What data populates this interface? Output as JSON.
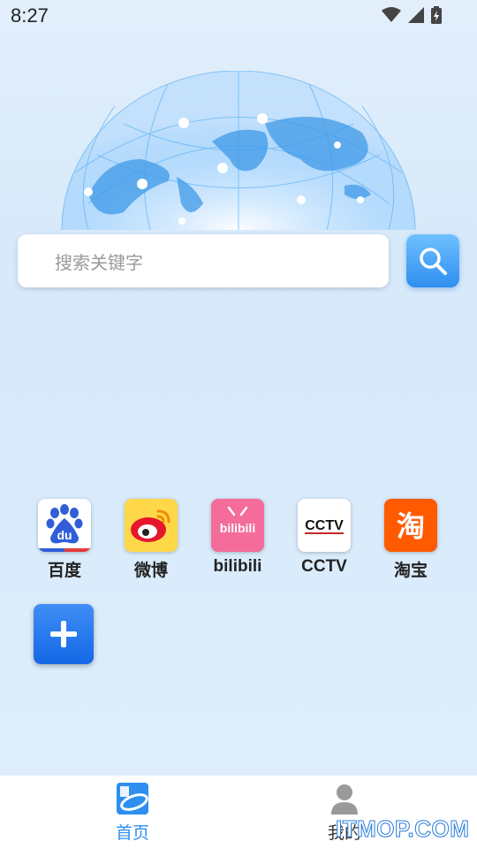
{
  "status_bar": {
    "time": "8:27"
  },
  "search": {
    "placeholder": "搜索关键字"
  },
  "shortcuts": [
    {
      "label": "百度",
      "icon": "baidu-icon",
      "tile_text": "du"
    },
    {
      "label": "微博",
      "icon": "weibo-icon"
    },
    {
      "label": "bilibili",
      "icon": "bilibili-icon",
      "tile_text": "bilibili"
    },
    {
      "label": "CCTV",
      "icon": "cctv-icon",
      "tile_text": "CCTV"
    },
    {
      "label": "淘宝",
      "icon": "taobao-icon",
      "tile_text": "淘"
    }
  ],
  "add_button": {
    "icon": "plus-icon"
  },
  "tabbar": {
    "tabs": [
      {
        "label": "首页",
        "active": true,
        "icon": "home-logo-icon"
      },
      {
        "label": "我的",
        "active": false,
        "icon": "person-icon"
      }
    ]
  },
  "watermark": "ITMOP.COM",
  "colors": {
    "accent": "#2f8ff0",
    "tab_active": "#2d8ff0",
    "tab_inactive": "#333333",
    "baidu_blue": "#2f5ed8",
    "bilibili_pink": "#f36c9a",
    "taobao_orange": "#ff5a00"
  }
}
